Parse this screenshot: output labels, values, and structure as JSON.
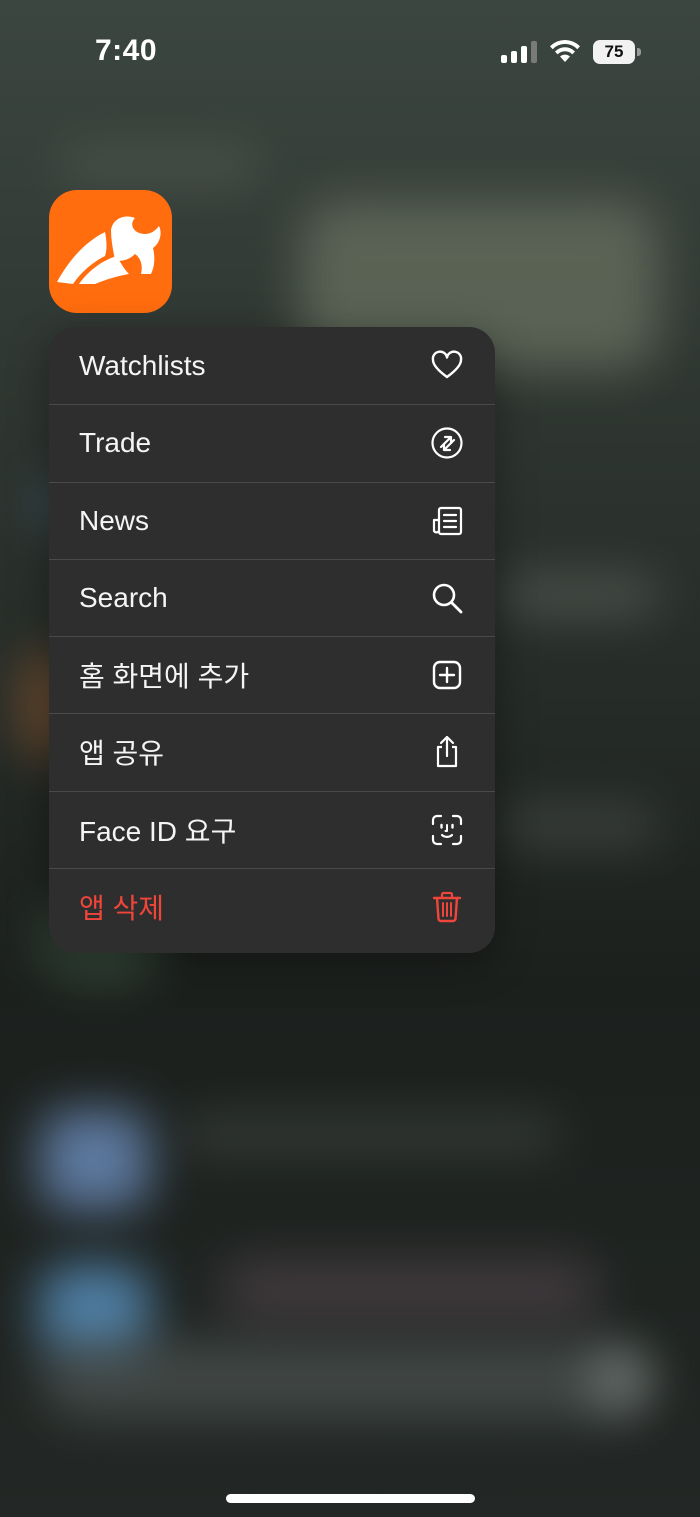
{
  "status_bar": {
    "time": "7:40",
    "battery_level": "75"
  },
  "app": {
    "name": "Webull",
    "icon_color": "#ff6d0e"
  },
  "context_menu": {
    "items": [
      {
        "label": "Watchlists",
        "icon": "heart-icon"
      },
      {
        "label": "Trade",
        "icon": "trade-arrows-icon"
      },
      {
        "label": "News",
        "icon": "newspaper-icon"
      },
      {
        "label": "Search",
        "icon": "search-icon"
      },
      {
        "label": "홈 화면에 추가",
        "icon": "add-square-icon"
      },
      {
        "label": "앱 공유",
        "icon": "share-icon"
      },
      {
        "label": "Face ID 요구",
        "icon": "face-id-icon"
      },
      {
        "label": "앱 삭제",
        "icon": "trash-icon",
        "destructive": true
      }
    ]
  },
  "colors": {
    "menu_background": "#2e2e2e",
    "destructive": "#f0453b",
    "text": "#f5f5f5"
  }
}
